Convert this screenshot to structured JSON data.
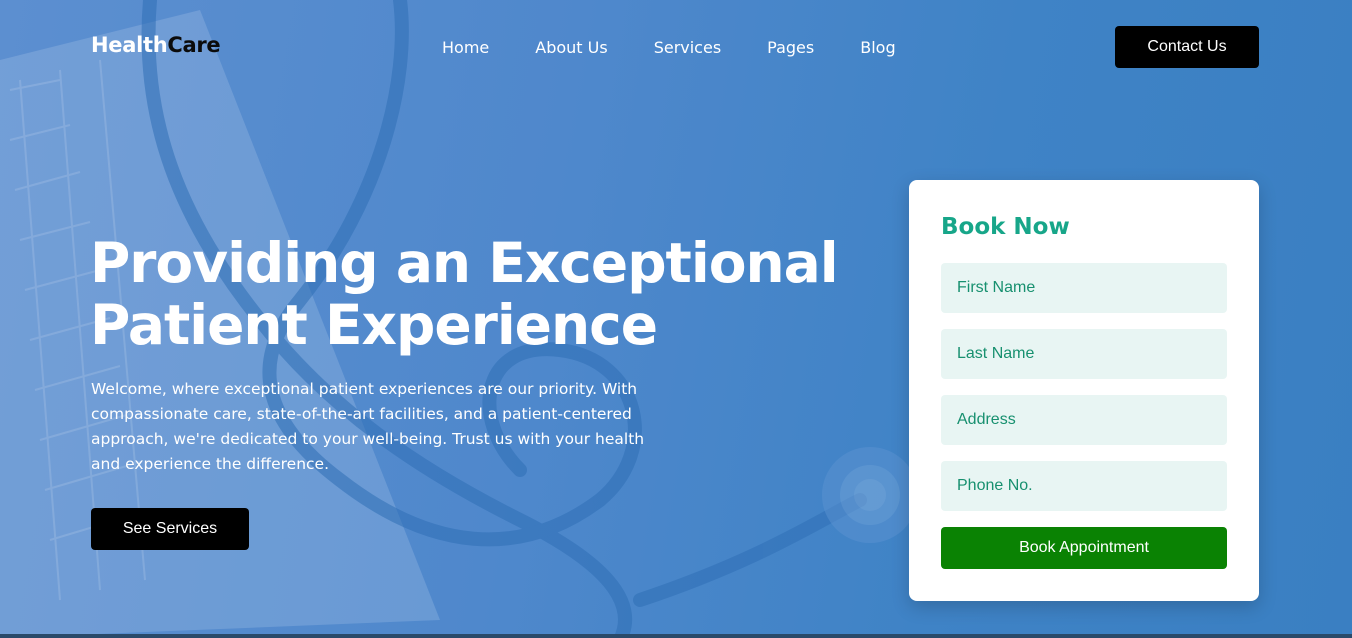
{
  "brand": {
    "part1": "Health",
    "part2": "Care"
  },
  "nav": {
    "items": [
      "Home",
      "About Us",
      "Services",
      "Pages",
      "Blog"
    ]
  },
  "header": {
    "contact_label": "Contact Us"
  },
  "hero": {
    "title_line1": "Providing an Exceptional",
    "title_line2": "Patient Experience",
    "intro": "Welcome, where exceptional patient experiences are our priority. With compassionate care, state-of-the-art facilities, and a patient-centered approach, we're dedicated to your well-being. Trust us with your health and experience the difference.",
    "cta_label": "See Services"
  },
  "booking": {
    "title": "Book Now",
    "fields": {
      "first_name": "First Name",
      "last_name": "Last Name",
      "address": "Address",
      "phone": "Phone No."
    },
    "submit_label": "Book Appointment"
  },
  "colors": {
    "accent_teal": "#17a689",
    "button_green": "#0a8203",
    "field_bg": "#e8f5f3",
    "hero_blue": "#4f88cc"
  }
}
